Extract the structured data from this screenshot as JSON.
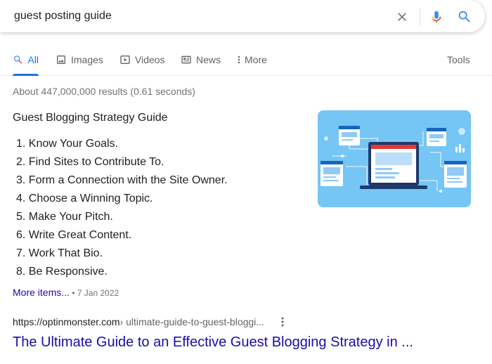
{
  "search": {
    "query": "guest posting guide"
  },
  "icons": {
    "clear": "close-icon",
    "mic": "microphone-icon",
    "search": "search-icon"
  },
  "colors": {
    "accent": "#1a73e8",
    "link": "#1a0dab",
    "image_bg": "#75c5f5"
  },
  "tabs": [
    {
      "label": "All",
      "icon": "search-icon",
      "active": true
    },
    {
      "label": "Images",
      "icon": "image-icon",
      "active": false
    },
    {
      "label": "Videos",
      "icon": "play-icon",
      "active": false
    },
    {
      "label": "News",
      "icon": "news-icon",
      "active": false
    },
    {
      "label": "More",
      "icon": "more-vert-icon",
      "active": false
    }
  ],
  "tools_label": "Tools",
  "result_stats": "About 447,000,000 results (0.61 seconds)",
  "featured_snippet": {
    "title": "Guest Blogging Strategy Guide",
    "items": [
      "1. Know Your Goals.",
      "2. Find Sites to Contribute To.",
      "3. Form a Connection with the Site Owner.",
      "4. Choose a Winning Topic.",
      "5. Make Your Pitch.",
      "6. Write Great Content.",
      "7. Work That Bio.",
      "8. Be Responsive."
    ],
    "more_items_label": "More items...",
    "separator": " • ",
    "date": "7 Jan 2022"
  },
  "result": {
    "cite_domain": "https://optinmonster.com",
    "cite_path": " › ultimate-guide-to-guest-bloggi...",
    "title": "The Ultimate Guide to an Effective Guest Blogging Strategy in ..."
  }
}
